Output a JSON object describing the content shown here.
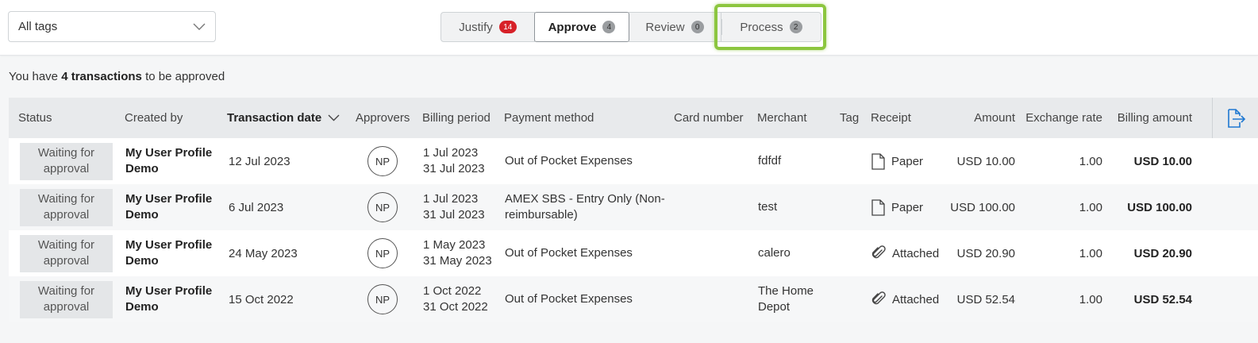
{
  "filter": {
    "selected": "All tags",
    "icon": "chevron-down-icon"
  },
  "tabs": [
    {
      "label": "Justify",
      "count": "14"
    },
    {
      "label": "Approve",
      "count": "4"
    },
    {
      "label": "Review",
      "count": "0"
    },
    {
      "label": "Process",
      "count": "2"
    }
  ],
  "summary": {
    "prefix": "You have",
    "count": "4 transactions",
    "suffix": "to be approved"
  },
  "columns": {
    "status": "Status",
    "created_by": "Created by",
    "transaction_date": "Transaction date",
    "approvers": "Approvers",
    "billing_period": "Billing period",
    "payment_method": "Payment method",
    "card_number": "Card number",
    "merchant": "Merchant",
    "tag": "Tag",
    "receipt": "Receipt",
    "amount": "Amount",
    "exchange_rate": "Exchange rate",
    "billing_amount": "Billing amount"
  },
  "rows": [
    {
      "status_1": "Waiting for",
      "status_2": "approval",
      "creator_1": "My User Profile",
      "creator_2": "Demo",
      "date": "12 Jul 2023",
      "approver": "NP",
      "period_start": "1 Jul 2023",
      "period_end": "31 Jul 2023",
      "payment_1": "Out of Pocket Expenses",
      "payment_2": "",
      "card": "",
      "merchant_1": "fdfdf",
      "merchant_2": "",
      "tag": "",
      "receipt_icon": "document-icon",
      "receipt": "Paper",
      "amount": "USD 10.00",
      "rate": "1.00",
      "billing": "USD 10.00"
    },
    {
      "status_1": "Waiting for",
      "status_2": "approval",
      "creator_1": "My User Profile",
      "creator_2": "Demo",
      "date": "6 Jul 2023",
      "approver": "NP",
      "period_start": "1 Jul 2023",
      "period_end": "31 Jul 2023",
      "payment_1": "AMEX SBS - Entry Only (Non-",
      "payment_2": "reimbursable)",
      "card": "",
      "merchant_1": "test",
      "merchant_2": "",
      "tag": "",
      "receipt_icon": "document-icon",
      "receipt": "Paper",
      "amount": "USD 100.00",
      "rate": "1.00",
      "billing": "USD 100.00"
    },
    {
      "status_1": "Waiting for",
      "status_2": "approval",
      "creator_1": "My User Profile",
      "creator_2": "Demo",
      "date": "24 May 2023",
      "approver": "NP",
      "period_start": "1 May 2023",
      "period_end": "31 May 2023",
      "payment_1": "Out of Pocket Expenses",
      "payment_2": "",
      "card": "",
      "merchant_1": "calero",
      "merchant_2": "",
      "tag": "",
      "receipt_icon": "paperclip-icon",
      "receipt": "Attached",
      "amount": "USD 20.90",
      "rate": "1.00",
      "billing": "USD 20.90"
    },
    {
      "status_1": "Waiting for",
      "status_2": "approval",
      "creator_1": "My User Profile",
      "creator_2": "Demo",
      "date": "15 Oct 2022",
      "approver": "NP",
      "period_start": "1 Oct 2022",
      "period_end": "31 Oct 2022",
      "payment_1": "Out of Pocket Expenses",
      "payment_2": "",
      "card": "",
      "merchant_1": "The Home",
      "merchant_2": "Depot",
      "tag": "",
      "receipt_icon": "paperclip-icon",
      "receipt": "Attached",
      "amount": "USD 52.54",
      "rate": "1.00",
      "billing": "USD 52.54"
    }
  ],
  "export_icon": "export-file-icon",
  "colors": {
    "badge_red": "#d72128",
    "highlight": "#8cc63f",
    "export_icon": "#1f78d1"
  }
}
